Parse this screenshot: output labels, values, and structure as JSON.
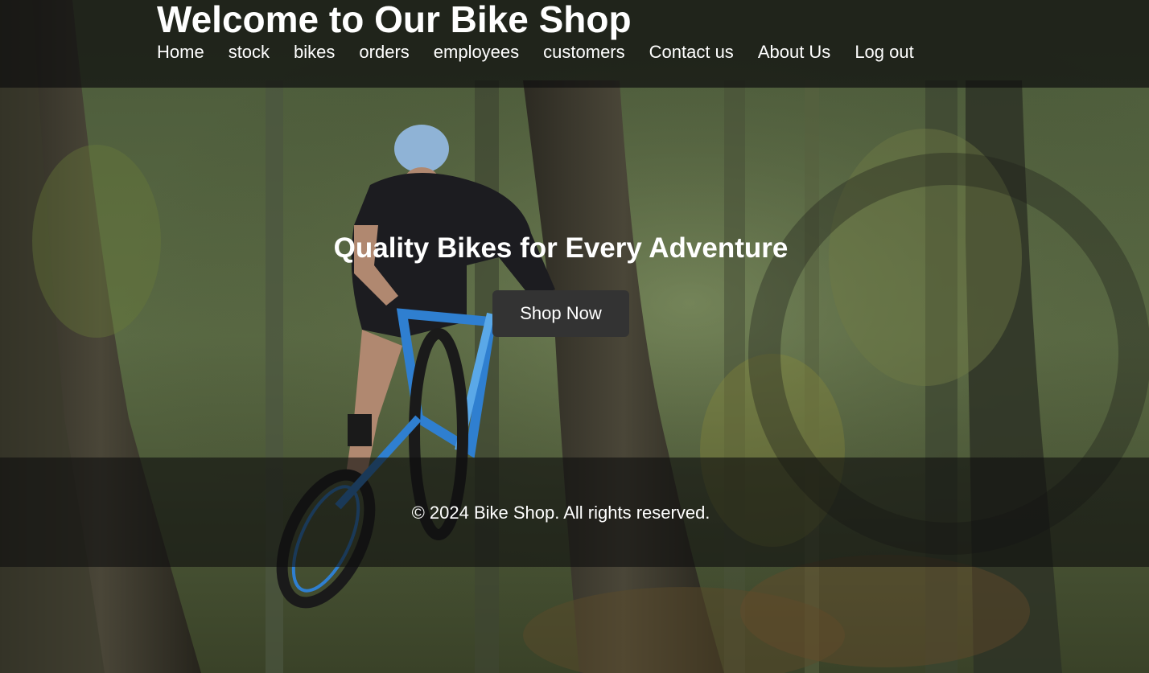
{
  "header": {
    "title": "Welcome to Our Bike Shop",
    "nav": [
      {
        "label": "Home"
      },
      {
        "label": "stock"
      },
      {
        "label": "bikes"
      },
      {
        "label": "orders"
      },
      {
        "label": "employees"
      },
      {
        "label": "customers"
      },
      {
        "label": "Contact us"
      },
      {
        "label": "About Us"
      },
      {
        "label": "Log out"
      }
    ]
  },
  "hero": {
    "heading": "Quality Bikes for Every Adventure",
    "button_label": "Shop Now"
  },
  "footer": {
    "text": "© 2024 Bike Shop. All rights reserved."
  },
  "colors": {
    "header_bg": "#0f0f0f",
    "button_bg": "#333333",
    "text": "#ffffff"
  }
}
